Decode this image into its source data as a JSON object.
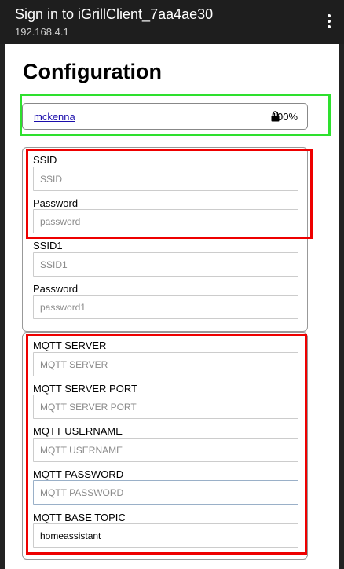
{
  "titlebar": {
    "title": "Sign in to iGrillClient_7aa4ae30",
    "subtitle": "192.168.4.1",
    "menu_icon": "more-vert-icon"
  },
  "page": {
    "heading": "Configuration"
  },
  "network": {
    "ssid": "mckenna",
    "quality": "100%",
    "lock_icon": "lock-icon"
  },
  "wifi": {
    "ssid_label": "SSID",
    "ssid_placeholder": "SSID",
    "password_label": "Password",
    "password_placeholder": "password",
    "ssid1_label": "SSID1",
    "ssid1_placeholder": "SSID1",
    "password1_label": "Password",
    "password1_placeholder": "password1"
  },
  "mqtt": {
    "server_label": "MQTT SERVER",
    "server_placeholder": "MQTT SERVER",
    "port_label": "MQTT SERVER PORT",
    "port_placeholder": "MQTT SERVER PORT",
    "username_label": "MQTT USERNAME",
    "username_placeholder": "MQTT USERNAME",
    "password_label": "MQTT PASSWORD",
    "password_placeholder": "MQTT PASSWORD",
    "base_topic_label": "MQTT BASE TOPIC",
    "base_topic_value": "homeassistant"
  },
  "colors": {
    "highlight_green": "#2ee02e",
    "highlight_red": "#ee0000",
    "link": "#1a0dab",
    "titlebar_bg": "#1e1e1e"
  }
}
